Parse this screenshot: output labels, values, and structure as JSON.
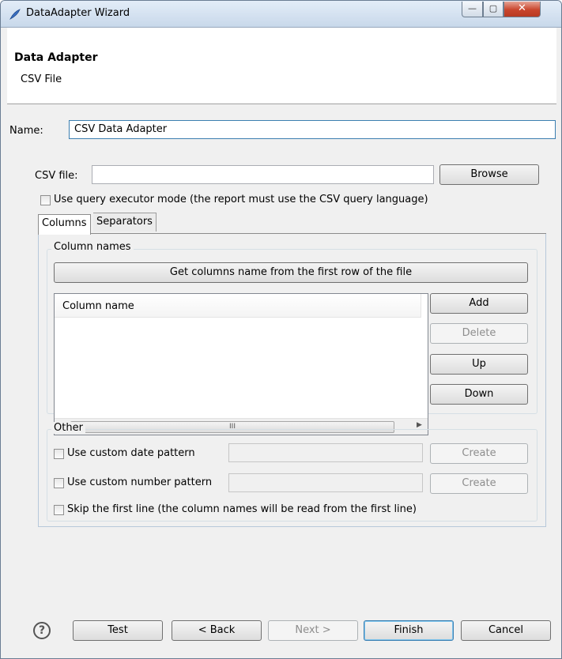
{
  "window": {
    "title": "DataAdapter Wizard",
    "min_glyph": "—",
    "max_glyph": "▢",
    "close_glyph": "✕"
  },
  "banner": {
    "title": "Data Adapter",
    "subtitle": "CSV File"
  },
  "name_field": {
    "label": "Name:",
    "value": "CSV Data Adapter"
  },
  "csv_file": {
    "label": "CSV file:",
    "value": "",
    "browse_label": "Browse"
  },
  "query_mode": {
    "label": "Use query executor mode (the report must use the CSV query language)",
    "checked": false
  },
  "tabs": [
    {
      "label": "Columns",
      "active": true
    },
    {
      "label": "Separators",
      "active": false
    }
  ],
  "column_names": {
    "legend": "Column names",
    "get_columns_label": "Get columns name from the first row of the file",
    "table_header": "Column name",
    "scroll_thumb_glyph": "III",
    "add_label": "Add",
    "delete_label": "Delete",
    "up_label": "Up",
    "down_label": "Down"
  },
  "other": {
    "legend": "Other",
    "date_pattern": {
      "label": "Use custom date pattern",
      "value": "",
      "create_label": "Create"
    },
    "number_pattern": {
      "label": "Use custom number pattern",
      "value": "",
      "create_label": "Create"
    },
    "skip_first_line": {
      "label": "Skip the first line (the column names will be read from the first line)"
    }
  },
  "footer": {
    "help_glyph": "?",
    "test_label": "Test",
    "back_label": "< Back",
    "next_label": "Next >",
    "finish_label": "Finish",
    "cancel_label": "Cancel"
  }
}
